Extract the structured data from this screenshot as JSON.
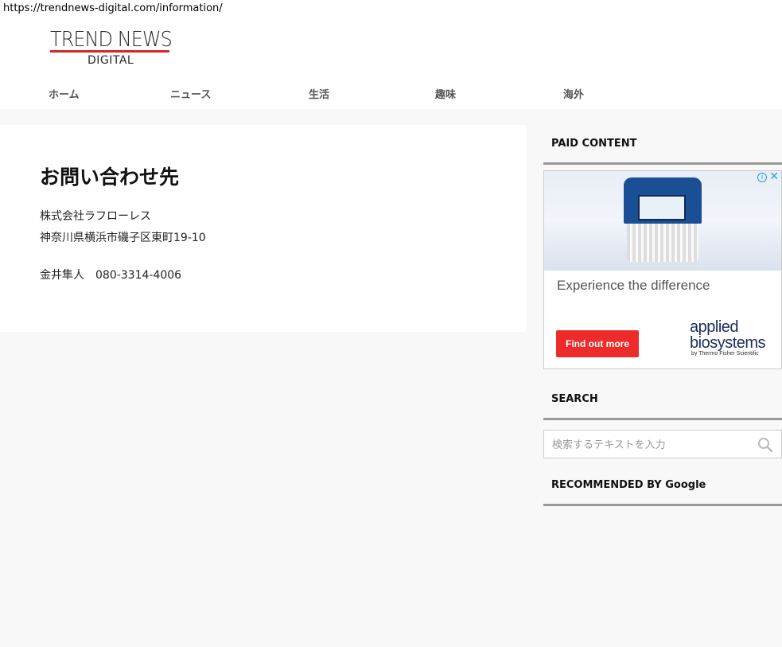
{
  "browser": {
    "url": "https://trendnews-digital.com/information/"
  },
  "site": {
    "logo_top": "TREND NEWS",
    "logo_sub": "DIGITAL"
  },
  "nav": {
    "items": [
      {
        "label": "ホーム"
      },
      {
        "label": "ニュース"
      },
      {
        "label": "生活"
      },
      {
        "label": "趣味"
      },
      {
        "label": "海外"
      }
    ]
  },
  "main": {
    "title": "お問い合わせ先",
    "company": "株式会社ラフローレス",
    "address": "神奈川県横浜市磯子区東町19-10",
    "contact": "金井隼人　080-3314-4006"
  },
  "sidebar": {
    "paid_title": "PAID CONTENT",
    "ad": {
      "headline": "Experience the difference",
      "cta": "Find out more",
      "brand_line1": "applied",
      "brand_line2": "biosystems",
      "brand_line3": "by Thermo Fisher Scientific",
      "info": "i",
      "close": "✕"
    },
    "search_title": "SEARCH",
    "search_placeholder": "検索するテキストを入力",
    "recommended_title": "RECOMMENDED BY Google"
  },
  "colors": {
    "page_bg": "#f8f8f8",
    "logo_accent": "#d6262b",
    "ad_cta": "#ee2b2b",
    "brand": "#1b2c5a"
  }
}
